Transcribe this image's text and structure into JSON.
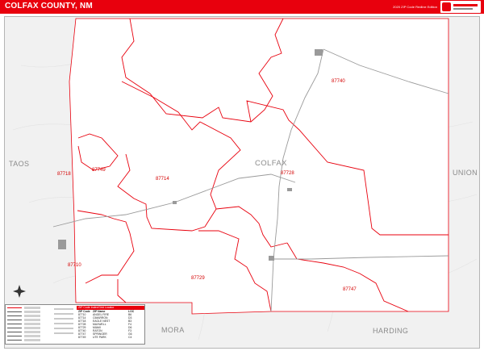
{
  "header": {
    "title": "COLFAX COUNTY, NM",
    "edition": "2020 ZIP Code Redline Edition"
  },
  "map": {
    "county_name": "COLFAX",
    "neighbors": [
      {
        "name": "TAOS"
      },
      {
        "name": "UNION"
      },
      {
        "name": "MORA"
      },
      {
        "name": "HARDING"
      }
    ],
    "zip_labels": [
      {
        "zip": "87740"
      },
      {
        "zip": "87718"
      },
      {
        "zip": "87749"
      },
      {
        "zip": "87714"
      },
      {
        "zip": "87728"
      },
      {
        "zip": "87710"
      },
      {
        "zip": "87729"
      },
      {
        "zip": "87747"
      }
    ],
    "colors": {
      "zip_boundary": "#e8000d",
      "road": "#9a9a9a",
      "background": "#f1f1f1",
      "header": "#e8000d"
    }
  },
  "legend": {
    "table_title": "ZIP Code Index/Grid Locator",
    "columns": {
      "zip": "ZIP Code",
      "name": "ZIP Name",
      "loc": "LOC"
    },
    "rows": [
      {
        "zip": "87710",
        "name": "ANGEL FIRE",
        "loc": "B6"
      },
      {
        "zip": "87714",
        "name": "CIMARRON",
        "loc": "D3"
      },
      {
        "zip": "87718",
        "name": "EAGLE NEST",
        "loc": "B3"
      },
      {
        "zip": "87728",
        "name": "MAXWELL",
        "loc": "F4"
      },
      {
        "zip": "87729",
        "name": "MIAMI",
        "loc": "D6"
      },
      {
        "zip": "87740",
        "name": "RATON",
        "loc": "F3"
      },
      {
        "zip": "87747",
        "name": "SPRINGER",
        "loc": "G6"
      },
      {
        "zip": "87749",
        "name": "UTE PARK",
        "loc": "C4"
      }
    ]
  }
}
